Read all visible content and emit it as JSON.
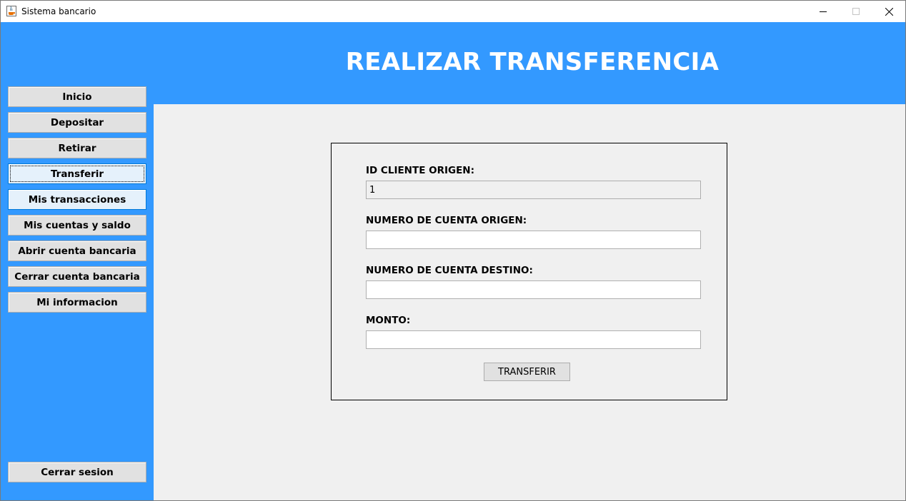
{
  "window": {
    "title": "Sistema bancario",
    "icon": "java-cup-icon",
    "controls": {
      "minimize_icon": "minimize-icon",
      "maximize_icon": "maximize-icon",
      "close_icon": "close-icon"
    }
  },
  "sidebar": {
    "items": [
      {
        "label": "Inicio"
      },
      {
        "label": "Depositar"
      },
      {
        "label": "Retirar"
      },
      {
        "label": "Transferir"
      },
      {
        "label": "Mis transacciones"
      },
      {
        "label": "Mis cuentas y saldo"
      },
      {
        "label": "Abrir cuenta bancaria"
      },
      {
        "label": "Cerrar cuenta bancaria"
      },
      {
        "label": "Mi informacion"
      }
    ],
    "logout_label": "Cerrar sesion"
  },
  "header": {
    "title": "REALIZAR TRANSFERENCIA"
  },
  "form": {
    "client_id_label": "ID CLIENTE ORIGEN:",
    "client_id_value": "1",
    "origin_account_label": "NUMERO DE CUENTA ORIGEN:",
    "origin_account_value": "",
    "dest_account_label": "NUMERO DE CUENTA DESTINO:",
    "dest_account_value": "",
    "amount_label": "MONTO:",
    "amount_value": "",
    "submit_label": "TRANSFERIR"
  },
  "colors": {
    "accent": "#3399ff",
    "panel_bg": "#f0f0f0",
    "button_bg": "#e1e1e1",
    "header_text": "#ffffff"
  }
}
